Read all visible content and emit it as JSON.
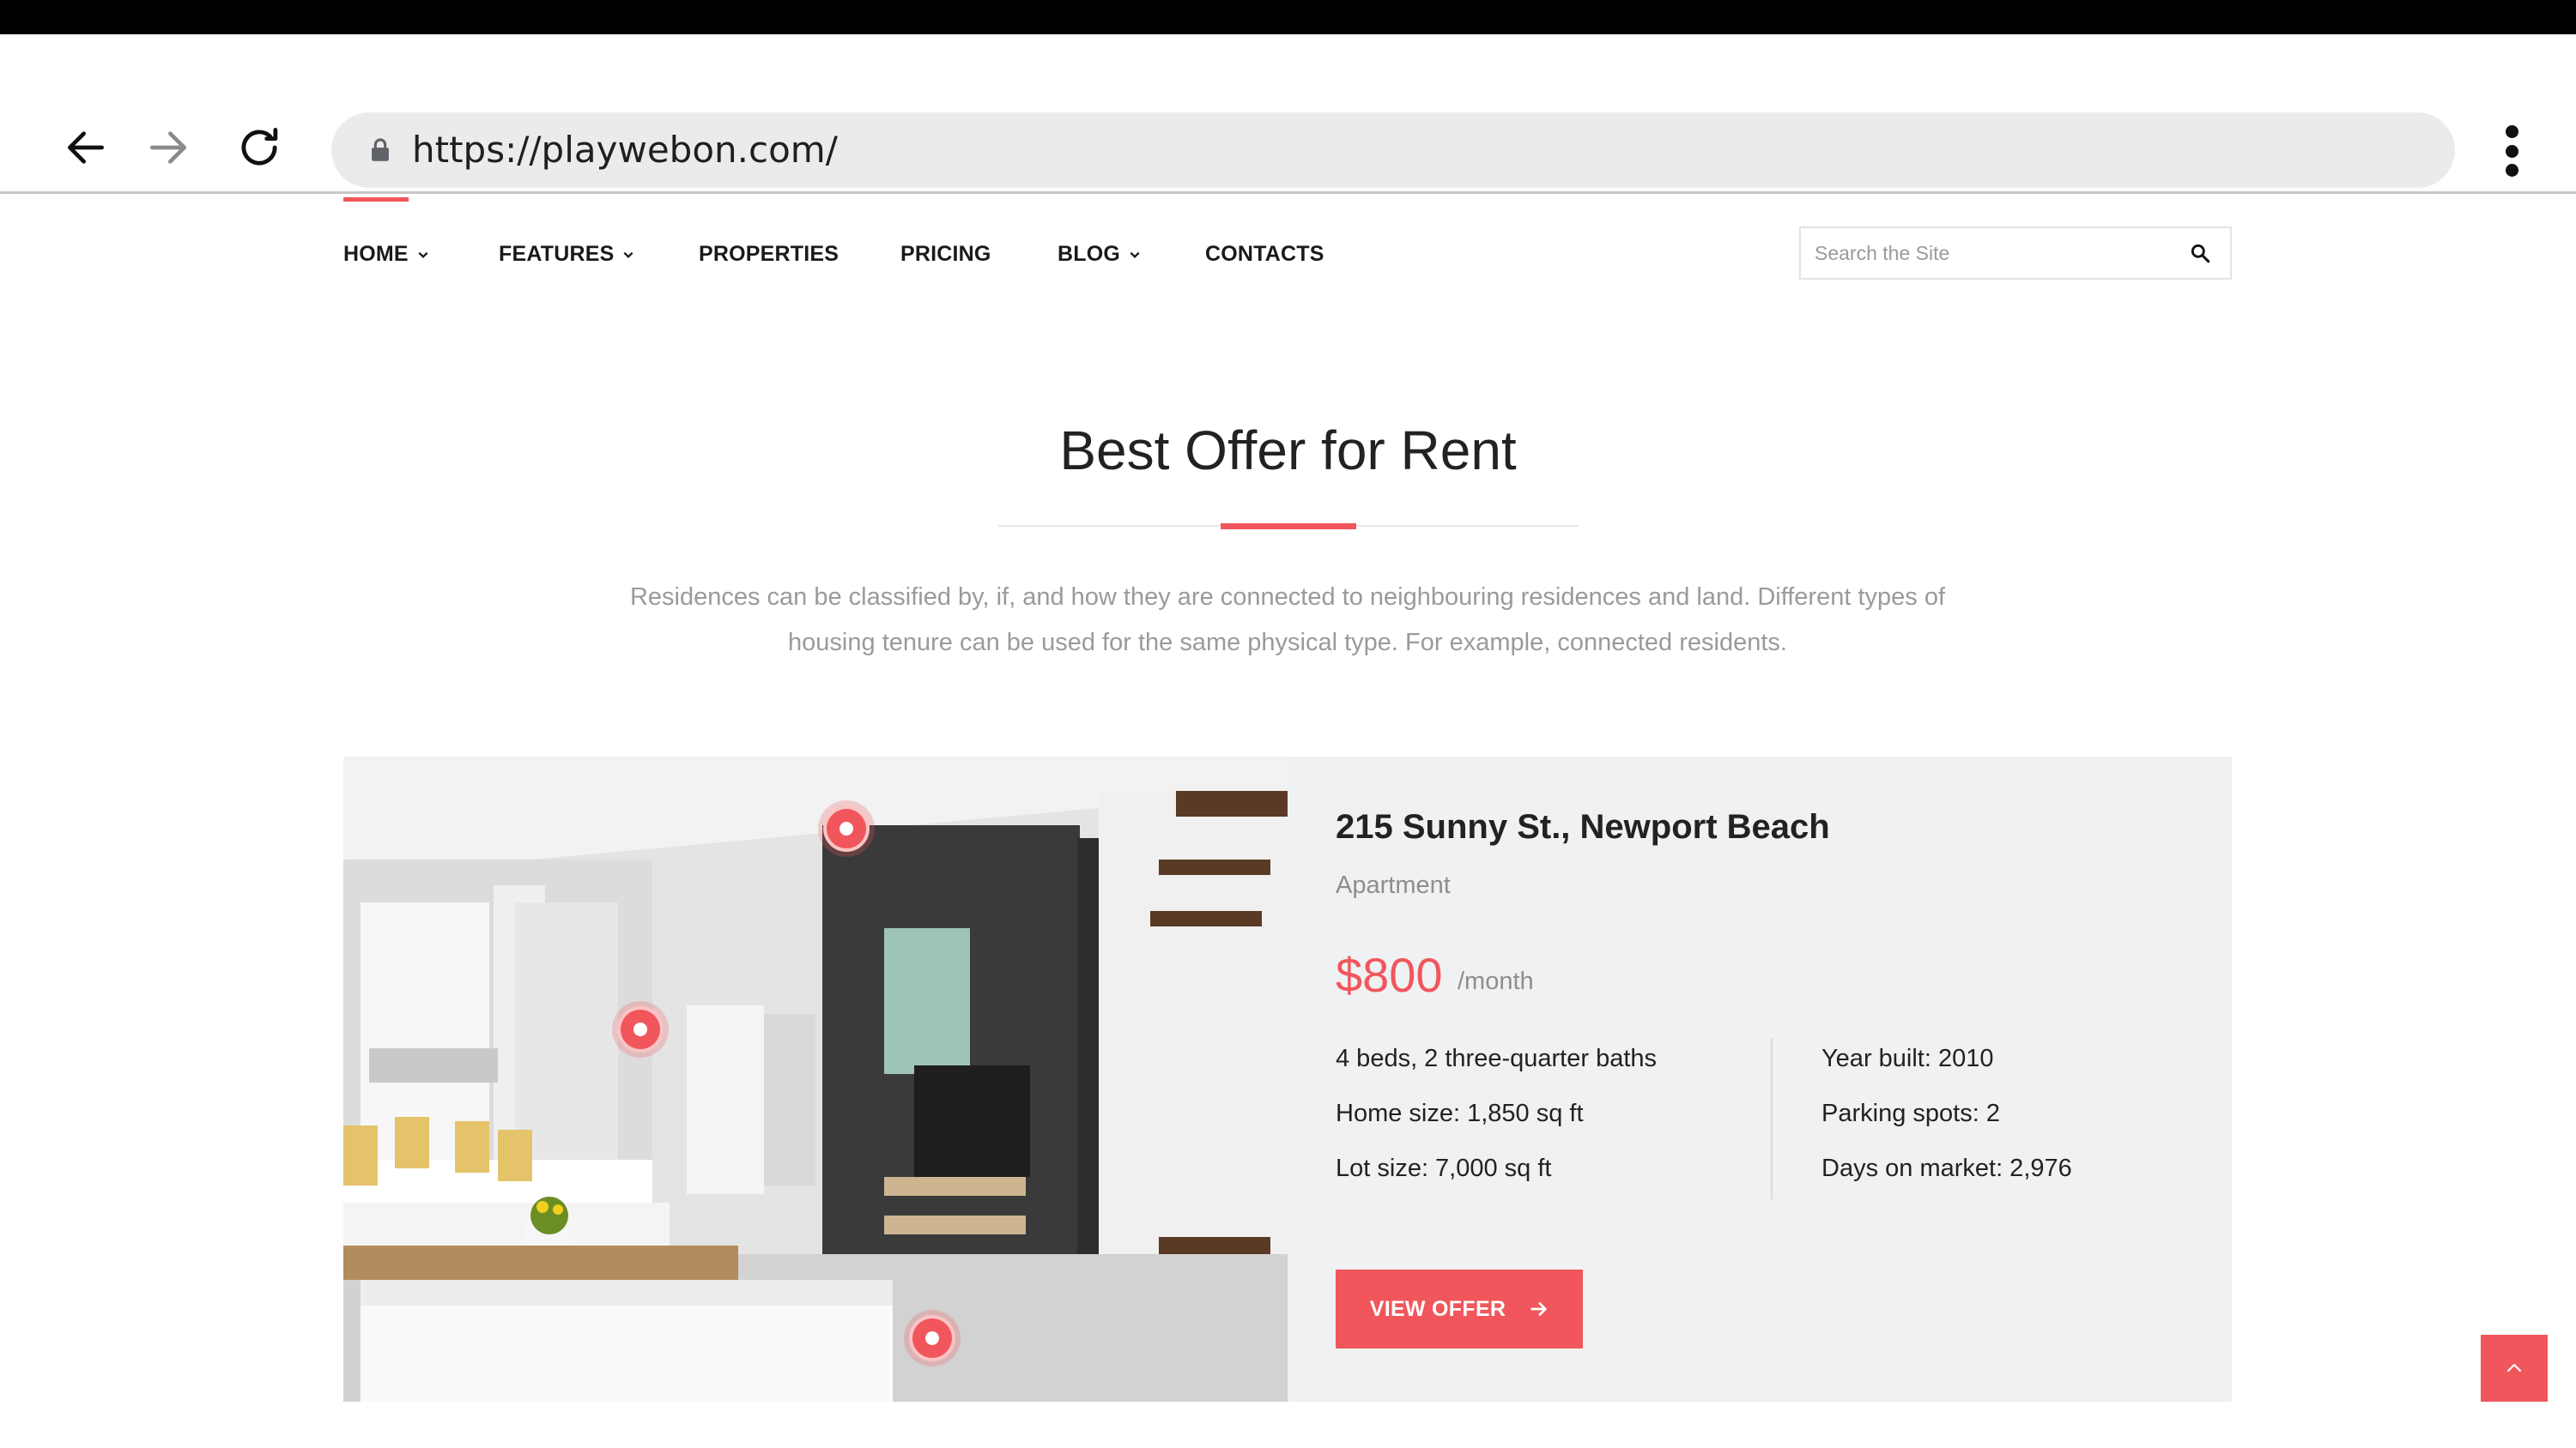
{
  "browser": {
    "url": "https://playwebon.com/",
    "icons": {
      "back": "arrow-left-icon",
      "forward": "arrow-right-icon",
      "reload": "reload-icon",
      "lock": "lock-icon",
      "menu": "more-vert-icon"
    }
  },
  "nav": {
    "items": [
      {
        "label": "HOME",
        "has_dropdown": true,
        "active": true
      },
      {
        "label": "FEATURES",
        "has_dropdown": true,
        "active": false
      },
      {
        "label": "PROPERTIES",
        "has_dropdown": false,
        "active": false
      },
      {
        "label": "PRICING",
        "has_dropdown": false,
        "active": false
      },
      {
        "label": "BLOG",
        "has_dropdown": true,
        "active": false
      },
      {
        "label": "CONTACTS",
        "has_dropdown": false,
        "active": false
      }
    ],
    "search": {
      "placeholder": "Search the Site",
      "value": ""
    }
  },
  "section": {
    "title": "Best Offer for Rent",
    "intro_line1": "Residences can be classified by, if, and how they are connected to neighbouring residences and land. Different types of",
    "intro_line2": "housing tenure can be used for the same physical type. For example, connected residents."
  },
  "offer": {
    "address": "215 Sunny St., Newport Beach",
    "type": "Apartment",
    "price": "$800",
    "period": "/month",
    "details_left": [
      "4 beds, 2 three-quarter baths",
      "Home size: 1,850 sq ft",
      "Lot size: 7,000 sq ft"
    ],
    "details_right": [
      "Year built: 2010",
      "Parking spots: 2",
      "Days on market: 2,976"
    ],
    "button_label": "VIEW OFFER"
  },
  "colors": {
    "accent": "#f0565b",
    "panel": "#eff1f2",
    "muted_text": "#9a9a9a"
  }
}
